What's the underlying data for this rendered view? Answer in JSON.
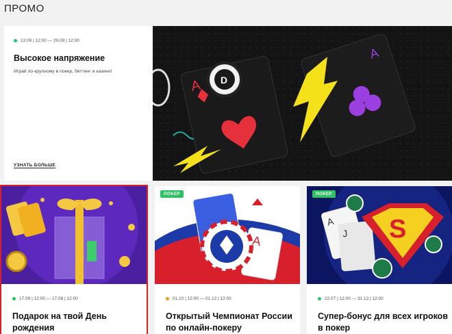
{
  "page": {
    "title": "ПРОМО"
  },
  "hero": {
    "date": "13.09 | 12:00 — 29.09 | 12:00",
    "title": "Высокое напряжение",
    "subtitle": "Играй по-крупному в покер, беттинг и казино!",
    "link": "УЗНАТЬ БОЛЬШЕ",
    "status_color": "#2ec262"
  },
  "cards": [
    {
      "badge": "",
      "date": "17.09 | 12:00 — 17.08 | 12:00",
      "title": "Подарок на твой День рождения",
      "status_color": "#2ec262"
    },
    {
      "badge": "ПОКЕР",
      "date": "01.10 | 12:00 — 01.12 | 12:00",
      "title": "Открытый Чемпионат России по онлайн-покеру",
      "status_color": "#f0a020"
    },
    {
      "badge": "ПОКЕР",
      "date": "22.07 | 12:00 — 31.12 | 12:00",
      "title": "Супер-бонус для всех игроков в покер",
      "status_color": "#2ec262"
    }
  ],
  "colors": {
    "accent": "#2ec262",
    "selected_outline": "#d8202c",
    "banner_bg": "#121212"
  }
}
